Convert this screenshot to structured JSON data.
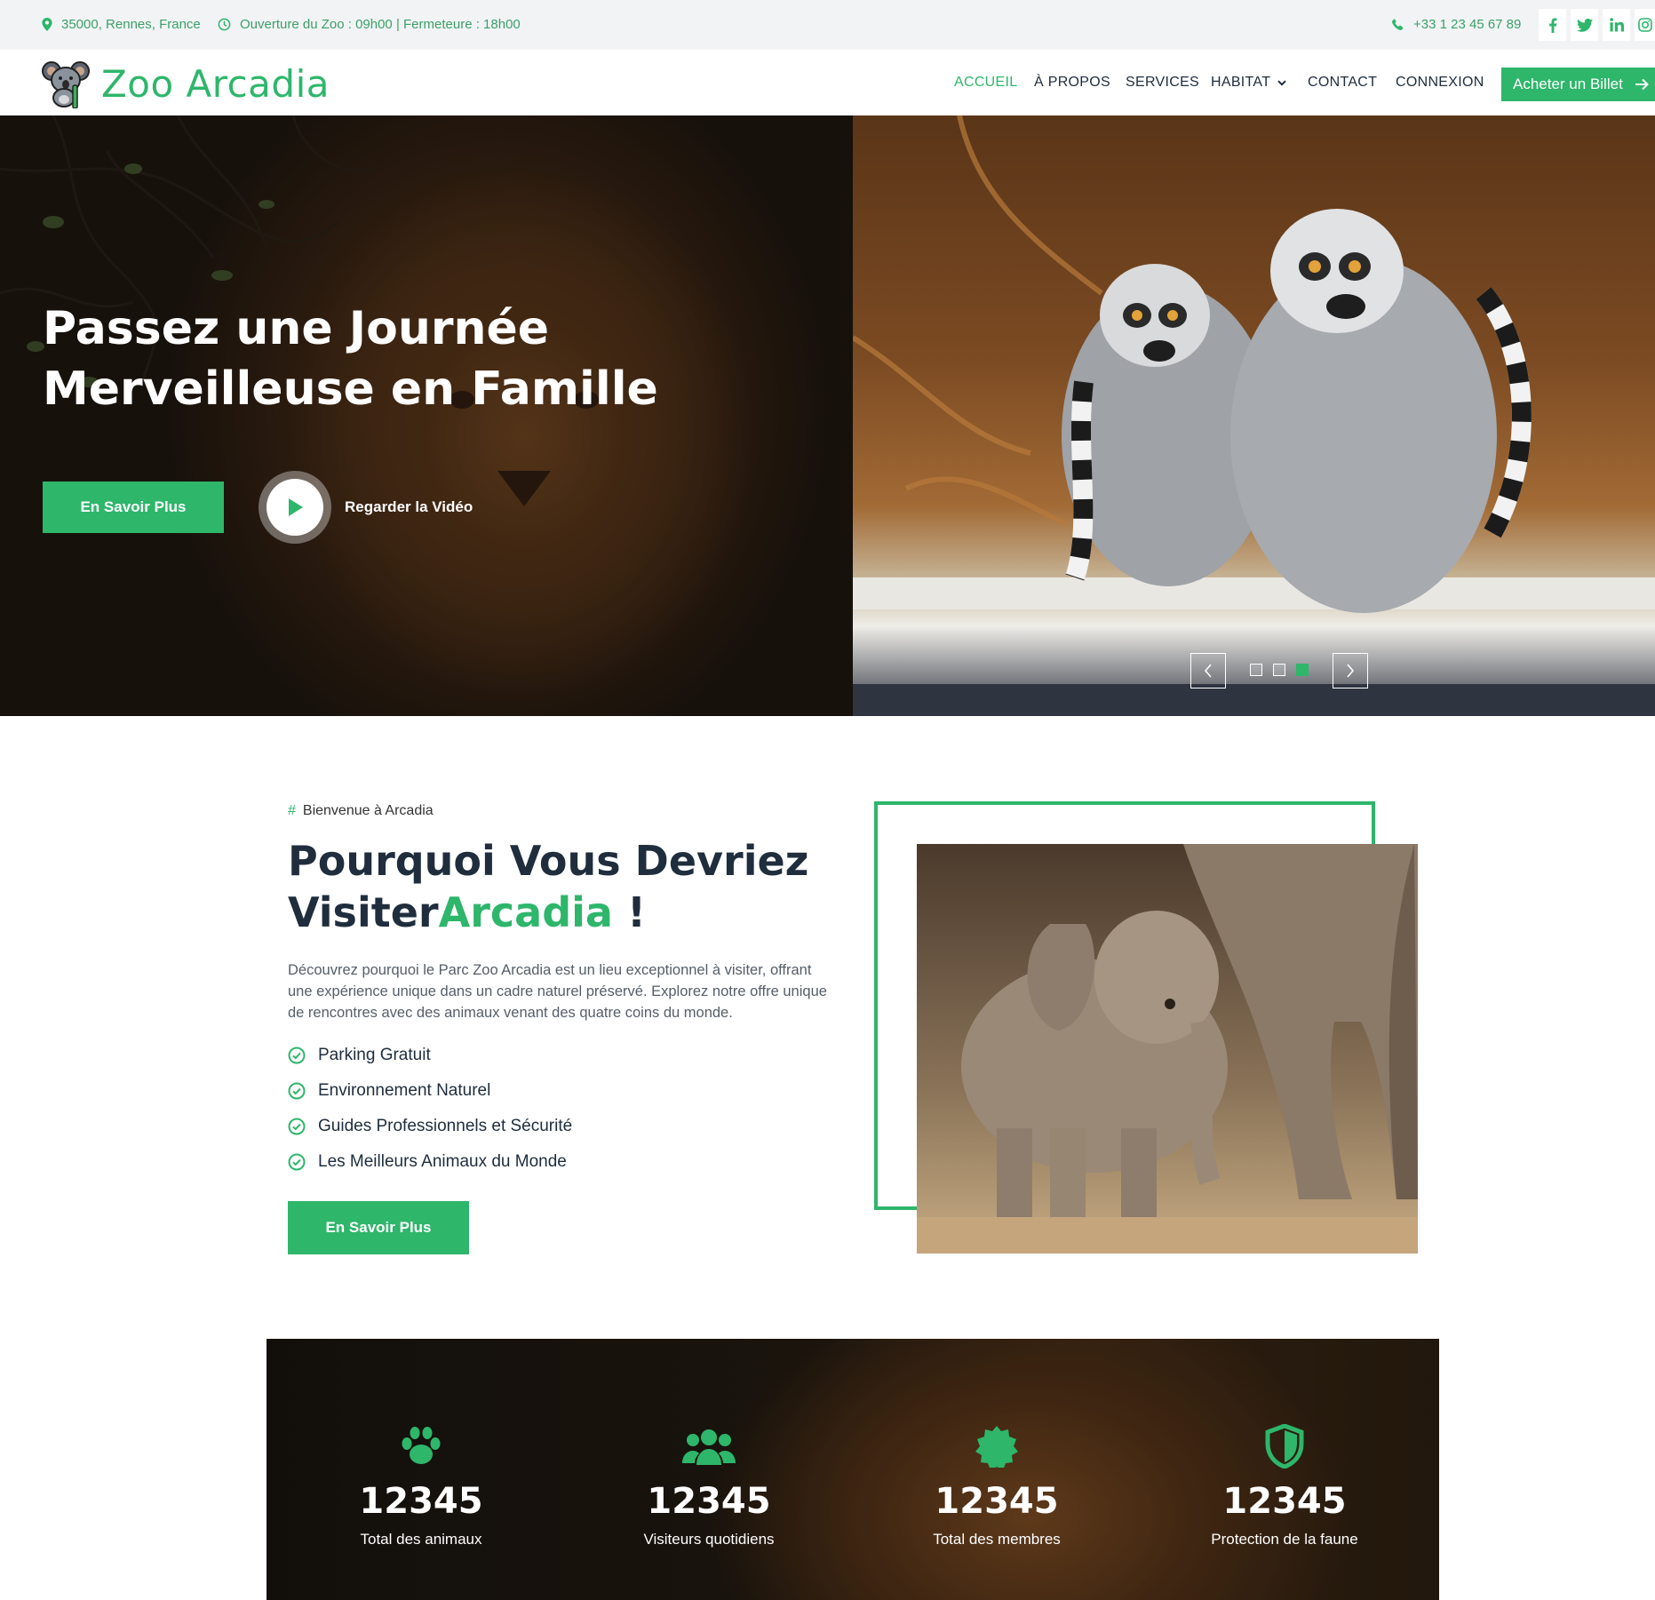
{
  "topbar": {
    "address": "35000, Rennes, France",
    "hours": "Ouverture du Zoo : 09h00 | Fermeteure : 18h00",
    "phone": "+33 1 23 45 67 89",
    "social": [
      "facebook-icon",
      "twitter-icon",
      "linkedin-icon",
      "instagram-icon"
    ]
  },
  "brand": {
    "name": "Zoo Arcadia",
    "color": "#2eb66b"
  },
  "nav": {
    "items": [
      {
        "label": "ACCUEIL",
        "active": true
      },
      {
        "label": "À PROPOS"
      },
      {
        "label": "SERVICES"
      },
      {
        "label": "HABITAT"
      },
      {
        "label": "CONTACT"
      },
      {
        "label": "CONNEXION"
      }
    ],
    "cta": "Acheter un Billet"
  },
  "hero": {
    "title": "Passez une Journée Merveilleuse en Famille",
    "button": "En Savoir Plus",
    "video_label": "Regarder la Vidéo",
    "slides_total": 3,
    "slide_active": 3
  },
  "about": {
    "kicker_hash": "#",
    "kicker": "Bienvenue à Arcadia",
    "title_part1": "Pourquoi Vous Devriez Visiter",
    "title_accent": "Arcadia",
    "title_end": " !",
    "description": "Découvrez pourquoi le Parc Zoo Arcadia est un lieu exceptionnel à visiter, offrant une expérience unique dans un cadre naturel préservé. Explorez notre offre unique de rencontres avec des animaux venant des quatre coins du monde.",
    "features": [
      "Parking Gratuit",
      "Environnement Naturel",
      "Guides Professionnels et Sécurité",
      "Les Meilleurs Animaux du Monde"
    ],
    "button": "En Savoir Plus"
  },
  "stats": [
    {
      "icon": "paw-icon",
      "value": "12345",
      "label": "Total des animaux"
    },
    {
      "icon": "users-icon",
      "value": "12345",
      "label": "Visiteurs quotidiens"
    },
    {
      "icon": "certificate-icon",
      "value": "12345",
      "label": "Total des membres"
    },
    {
      "icon": "shield-icon",
      "value": "12345",
      "label": "Protection de la faune"
    }
  ]
}
